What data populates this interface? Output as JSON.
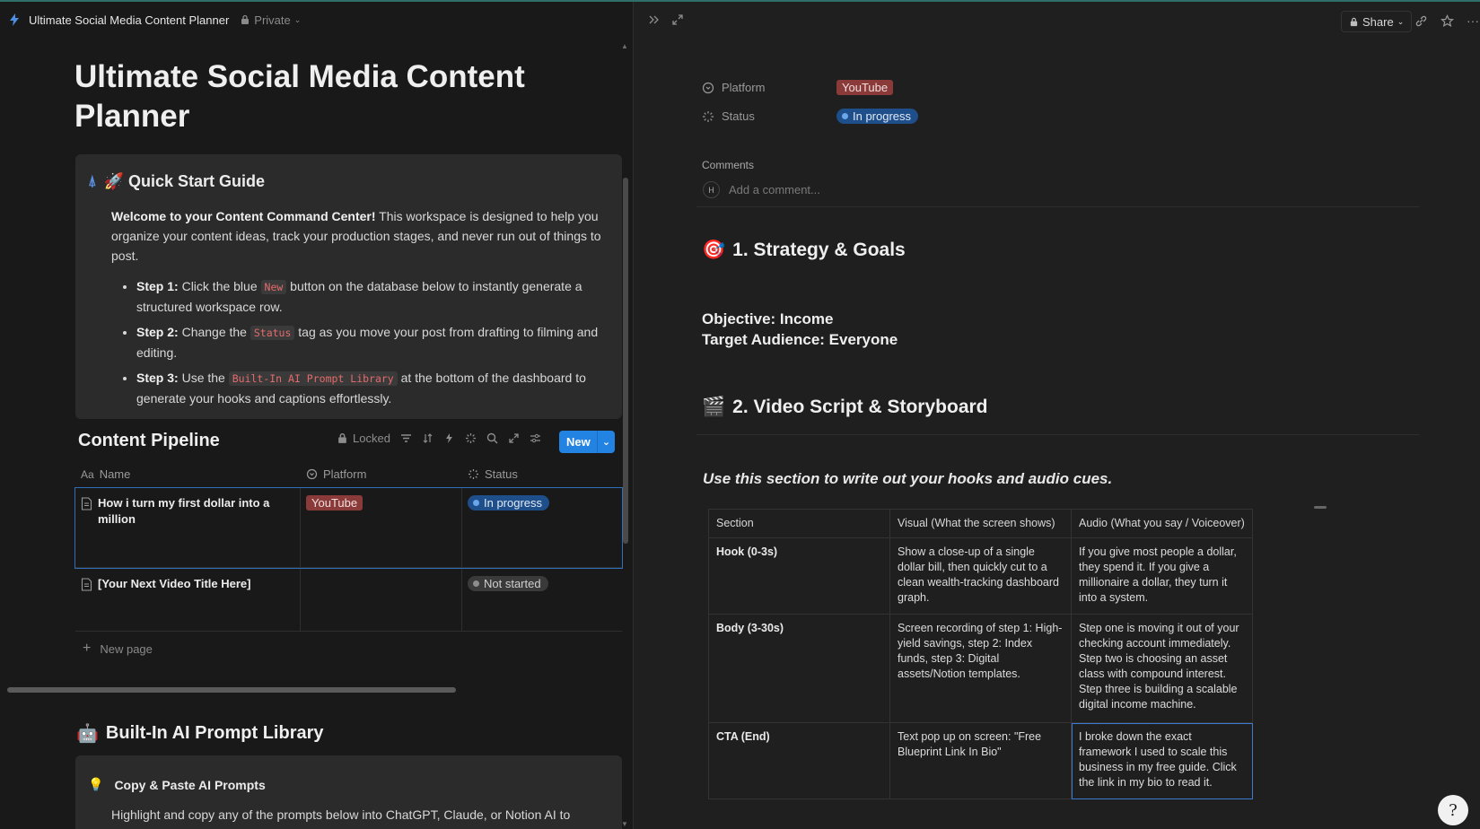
{
  "topbar": {
    "title": "Ultimate Social Media Content Planner",
    "privacy": "Private"
  },
  "page": {
    "title": "Ultimate Social Media Content Planner"
  },
  "quick_start": {
    "title": "🚀 Quick Start Guide",
    "intro_bold": "Welcome to your Content Command Center!",
    "intro_rest": " This workspace is designed to help you organize your content ideas, track your production stages, and never run out of things to post.",
    "step1_label": "Step 1:",
    "step1_a": " Click the blue ",
    "step1_code": "New",
    "step1_b": " button on the database below to instantly generate a structured workspace row.",
    "step2_label": "Step 2:",
    "step2_a": " Change the ",
    "step2_code": "Status",
    "step2_b": " tag as you move your post from drafting to filming and editing.",
    "step3_label": "Step 3:",
    "step3_a": " Use the ",
    "step3_code": "Built-In AI Prompt Library",
    "step3_b": " at the bottom of the dashboard to generate your hooks and captions effortlessly."
  },
  "database": {
    "title": "Content Pipeline",
    "locked_label": "Locked",
    "new_label": "New",
    "columns": {
      "name": "Name",
      "name_icon": "Aa",
      "platform": "Platform",
      "status": "Status"
    },
    "rows": [
      {
        "name": "How i turn my first dollar into a million",
        "platform": "YouTube",
        "status": "In progress"
      },
      {
        "name": "[Your Next Video Title Here]",
        "platform": "",
        "status": "Not started"
      }
    ],
    "new_page_label": "New page"
  },
  "prompt_library": {
    "title": "Built-In AI Prompt Library",
    "callout_title": "Copy & Paste AI Prompts",
    "callout_body": "Highlight and copy any of the prompts below into ChatGPT, Claude, or Notion AI to"
  },
  "detail": {
    "share_label": "Share",
    "properties": {
      "platform_label": "Platform",
      "platform_value": "YouTube",
      "status_label": "Status",
      "status_value": "In progress"
    },
    "comments_label": "Comments",
    "avatar_initial": "H",
    "comment_placeholder": "Add a comment...",
    "section1_title": "1. Strategy & Goals",
    "objective": "Objective: Income",
    "audience": "Target Audience: Everyone",
    "section2_title": "2. Video Script & Storyboard",
    "section2_note": "Use this section to write out your hooks and audio cues.",
    "table": {
      "headers": [
        "Section",
        "Visual (What the screen shows)",
        "Audio (What you say / Voiceover)"
      ],
      "rows": [
        [
          "Hook (0-3s)",
          "Show a close-up of a single dollar bill, then quickly cut to a clean wealth-tracking dashboard graph.",
          "If you give most people a dollar, they spend it. If you give a millionaire a dollar, they turn it into a system."
        ],
        [
          "Body (3-30s)",
          "Screen recording of step 1: High-yield savings, step 2: Index funds, step 3: Digital assets/Notion templates.",
          "Step one is moving it out of your checking account immediately. Step two is choosing an asset class with compound interest. Step three is building a scalable digital income machine."
        ],
        [
          "CTA (End)",
          "Text pop up on screen: \"Free Blueprint Link In Bio\"",
          "I broke down the exact framework I used to scale this business in my free guide. Click the link in my bio to read it."
        ]
      ]
    },
    "help_glyph": "?"
  },
  "colors": {
    "accent_blue": "#2383e2",
    "youtube_tag": "#8b3a3a",
    "in_progress": "#1f4f8a",
    "code_red": "#e56b6b"
  }
}
